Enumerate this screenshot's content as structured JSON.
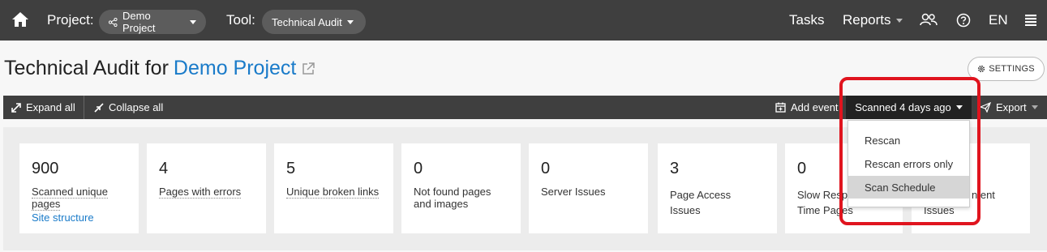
{
  "nav": {
    "project_label": "Project:",
    "project_value": "Demo Project",
    "tool_label": "Tool:",
    "tool_value": "Technical Audit",
    "tasks": "Tasks",
    "reports": "Reports",
    "language": "EN"
  },
  "page": {
    "title_prefix": "Technical Audit for",
    "title_project": "Demo Project",
    "settings_label": "SETTINGS"
  },
  "toolbar": {
    "expand_all": "Expand all",
    "collapse_all": "Collapse all",
    "add_event": "Add event",
    "scanned": "Scanned 4 days ago",
    "export": "Export"
  },
  "cards": [
    {
      "value": "900",
      "label_line1": "Scanned unique",
      "label_line2": "pages",
      "link": "Site structure"
    },
    {
      "value": "4",
      "label": "Pages with errors"
    },
    {
      "value": "5",
      "label": "Unique broken links"
    },
    {
      "value": "0",
      "label_line1": "Not found pages",
      "label_line2": "and images"
    },
    {
      "value": "0",
      "label": "Server Issues"
    },
    {
      "value": "3",
      "label_line1": "Page Access",
      "label_line2": "Issues"
    },
    {
      "value": "0",
      "label_line1": "Slow Respo",
      "label_line2": "Time Pages"
    },
    {
      "label_line1": "ntent",
      "label_line2": "Issues"
    }
  ],
  "dropdown": {
    "items": [
      "Rescan",
      "Rescan errors only",
      "Scan Schedule"
    ],
    "active": "Scan Schedule"
  },
  "colors": {
    "topbar": "#3f3f3f",
    "link": "#1a7bc9",
    "highlight": "#e0141e"
  }
}
